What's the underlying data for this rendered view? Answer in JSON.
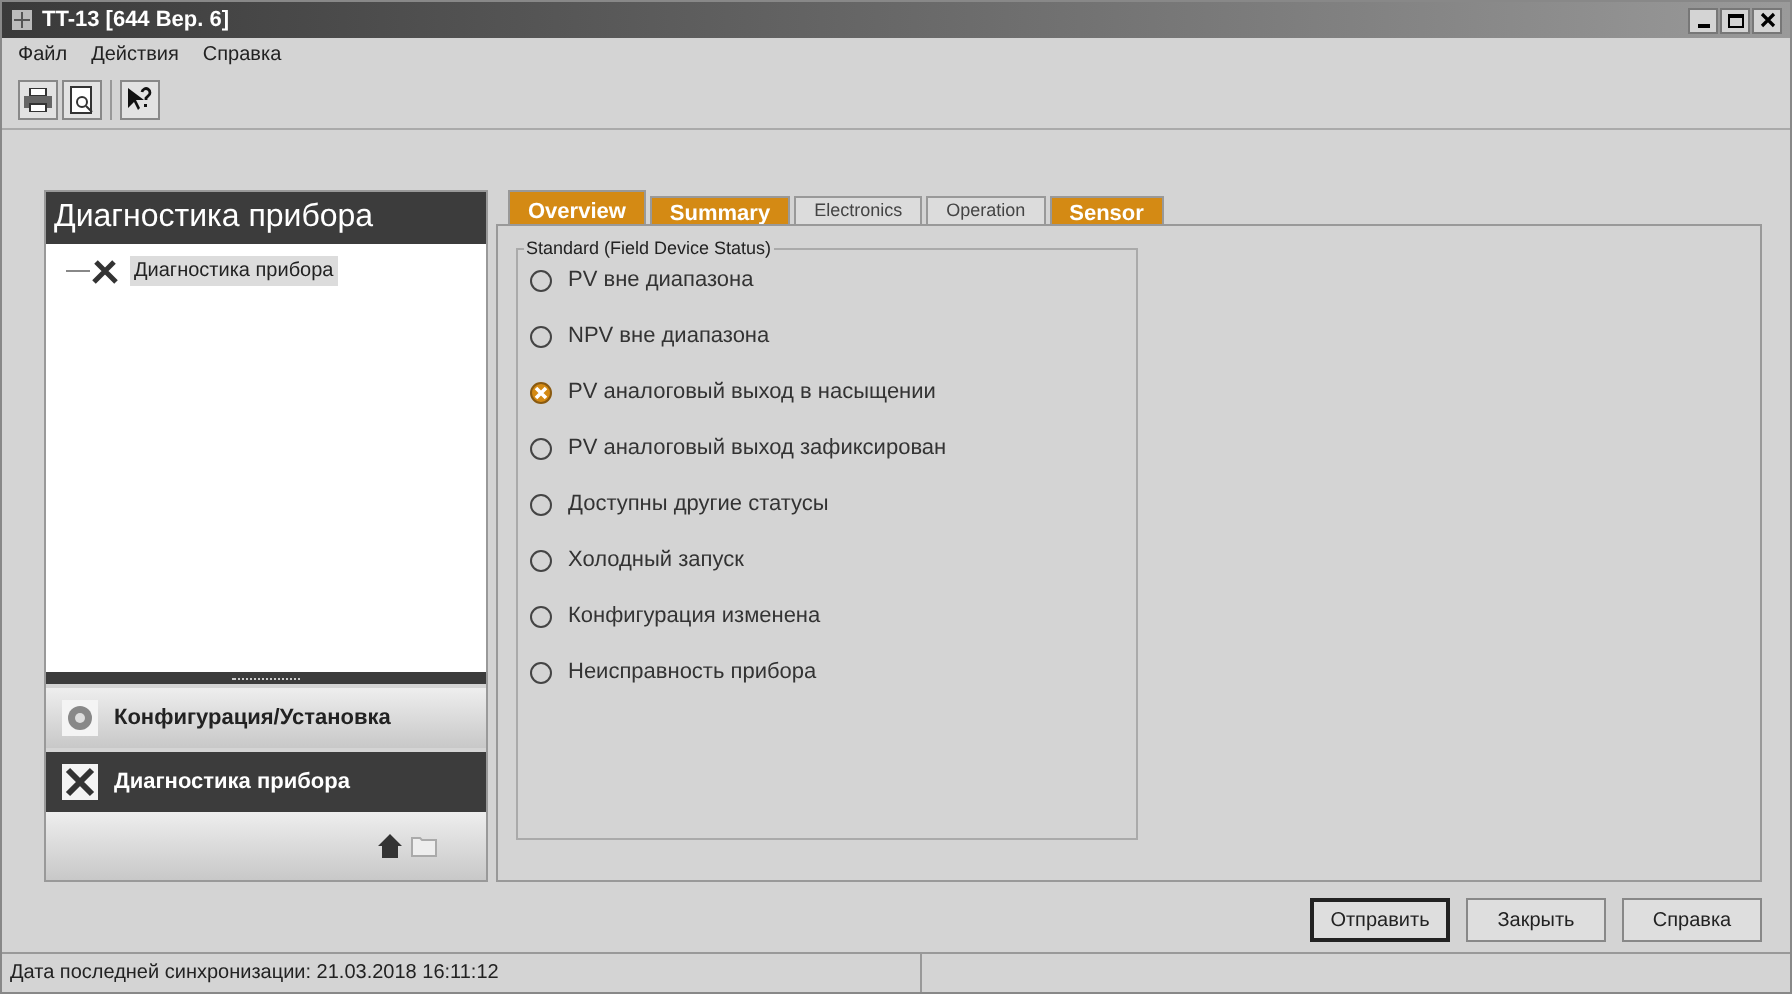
{
  "window": {
    "title": "TT-13 [644 Вер. 6]"
  },
  "menu": [
    "Файл",
    "Действия",
    "Справка"
  ],
  "navigator": {
    "title": "Диагностика прибора",
    "tree": [
      {
        "label": "Диагностика прибора",
        "selected": true
      }
    ],
    "sections": [
      {
        "label": "Конфигурация/Установка",
        "selected": false,
        "kind": "config"
      },
      {
        "label": "Диагностика прибора",
        "selected": true,
        "kind": "diagnostics"
      }
    ]
  },
  "tabs": [
    {
      "label": "Overview",
      "selected": true,
      "alert": true
    },
    {
      "label": "Summary",
      "selected": false,
      "alert": true
    },
    {
      "label": "Electronics",
      "selected": false,
      "alert": false
    },
    {
      "label": "Operation",
      "selected": false,
      "alert": false
    },
    {
      "label": "Sensor",
      "selected": false,
      "alert": true
    }
  ],
  "group": {
    "title": "Standard (Field Device Status)",
    "items": [
      {
        "label": "PV вне диапазона",
        "active": false
      },
      {
        "label": "NPV вне диапазона",
        "active": false
      },
      {
        "label": "PV аналоговый выход в насыщении",
        "active": true
      },
      {
        "label": "PV аналоговый выход зафиксирован",
        "active": false
      },
      {
        "label": "Доступны другие статусы",
        "active": false
      },
      {
        "label": "Холодный запуск",
        "active": false
      },
      {
        "label": "Конфигурация изменена",
        "active": false
      },
      {
        "label": "Неисправность прибора",
        "active": false
      }
    ]
  },
  "buttons": [
    "Отправить",
    "Закрыть",
    "Справка"
  ],
  "status_bar": "Дата последней синхронизации: 21.03.2018 16:11:12"
}
